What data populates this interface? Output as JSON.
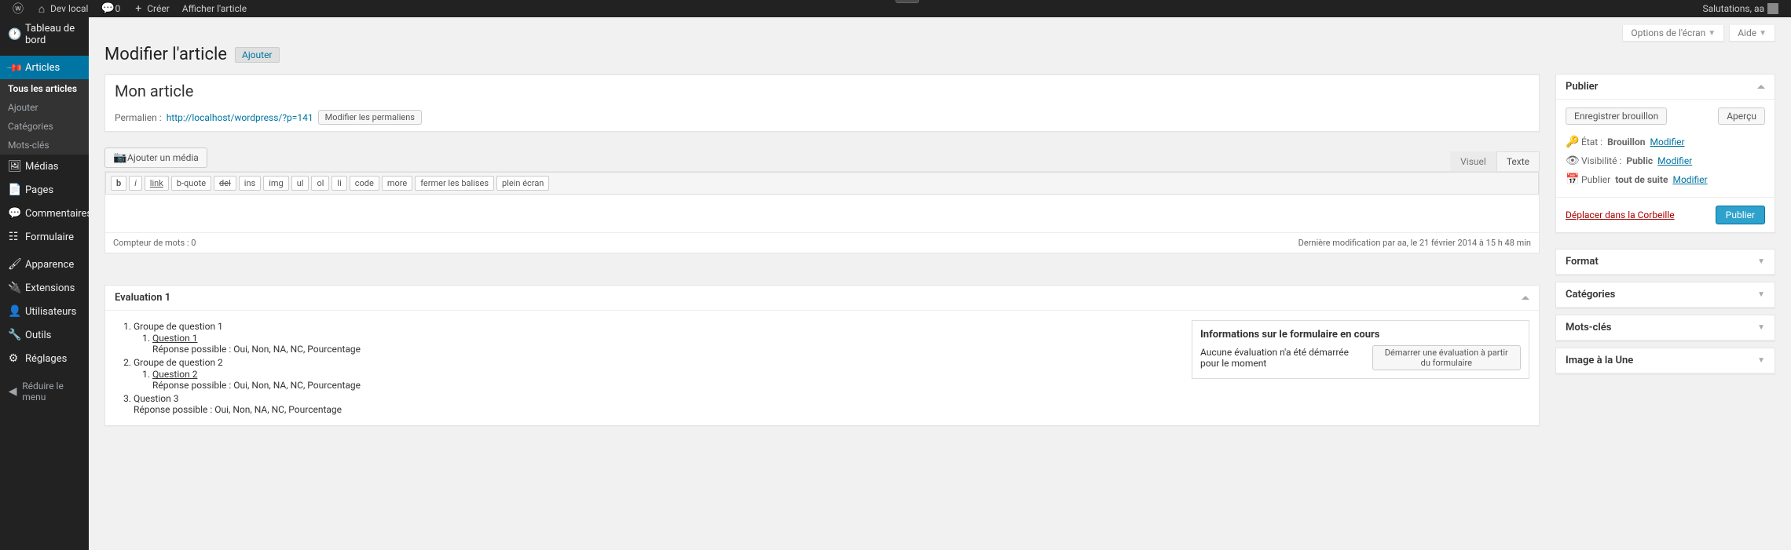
{
  "adminbar": {
    "site_name": "Dev local",
    "comments_count": "0",
    "create": "Créer",
    "show_article": "Afficher l'article",
    "greeting": "Salutations, aa"
  },
  "sidebar": {
    "dashboard": "Tableau de bord",
    "articles": "Articles",
    "sub_all": "Tous les articles",
    "sub_add": "Ajouter",
    "sub_categories": "Catégories",
    "sub_tags": "Mots-clés",
    "media": "Médias",
    "pages": "Pages",
    "comments": "Commentaires",
    "form": "Formulaire",
    "appearance": "Apparence",
    "extensions": "Extensions",
    "users": "Utilisateurs",
    "tools": "Outils",
    "settings": "Réglages",
    "collapse": "Réduire le menu"
  },
  "screen": {
    "options": "Options de l'écran",
    "help": "Aide"
  },
  "page": {
    "title": "Modifier l'article",
    "add_new": "Ajouter"
  },
  "editor": {
    "title_value": "Mon article",
    "permalink_label": "Permalien :",
    "permalink_url": "http://localhost/wordpress/?p=141",
    "edit_permalink": "Modifier les permaliens",
    "add_media": "Ajouter un média",
    "tab_visual": "Visuel",
    "tab_text": "Texte",
    "toolbar": [
      "b",
      "i",
      "link",
      "b-quote",
      "del",
      "ins",
      "img",
      "ul",
      "ol",
      "li",
      "code",
      "more",
      "fermer les balises",
      "plein écran"
    ],
    "word_count": "Compteur de mots : 0",
    "last_modified": "Dernière modification par aa, le 21 février 2014 à 15 h 48 min"
  },
  "publish": {
    "title": "Publier",
    "save_draft": "Enregistrer brouillon",
    "preview": "Aperçu",
    "status_label": "État :",
    "status_value": "Brouillon",
    "modify": "Modifier",
    "visibility_label": "Visibilité :",
    "visibility_value": "Public",
    "schedule_label": "Publier",
    "schedule_value": "tout de suite",
    "trash": "Déplacer dans la Corbeille",
    "publish_btn": "Publier"
  },
  "sideboxes": {
    "format": "Format",
    "categories": "Catégories",
    "tags": "Mots-clés",
    "featured": "Image à la Une"
  },
  "evaluation": {
    "title": "Evaluation 1",
    "groups": [
      {
        "label": "Groupe de question 1",
        "questions": [
          {
            "label": "Question 1",
            "answers": "Réponse possible : Oui, Non, NA, NC, Pourcentage"
          }
        ]
      },
      {
        "label": "Groupe de question 2",
        "questions": [
          {
            "label": "Question 2",
            "answers": "Réponse possible : Oui, Non, NA, NC, Pourcentage"
          }
        ]
      },
      {
        "label": "Question 3",
        "questions": [
          {
            "label": null,
            "answers": "Réponse possible : Oui, Non, NA, NC, Pourcentage"
          }
        ]
      }
    ],
    "info_title": "Informations sur le formulaire en cours",
    "info_text": "Aucune évaluation n'a été démarrée pour le moment",
    "start_btn": "Démarrer une évaluation à partir du formulaire"
  }
}
